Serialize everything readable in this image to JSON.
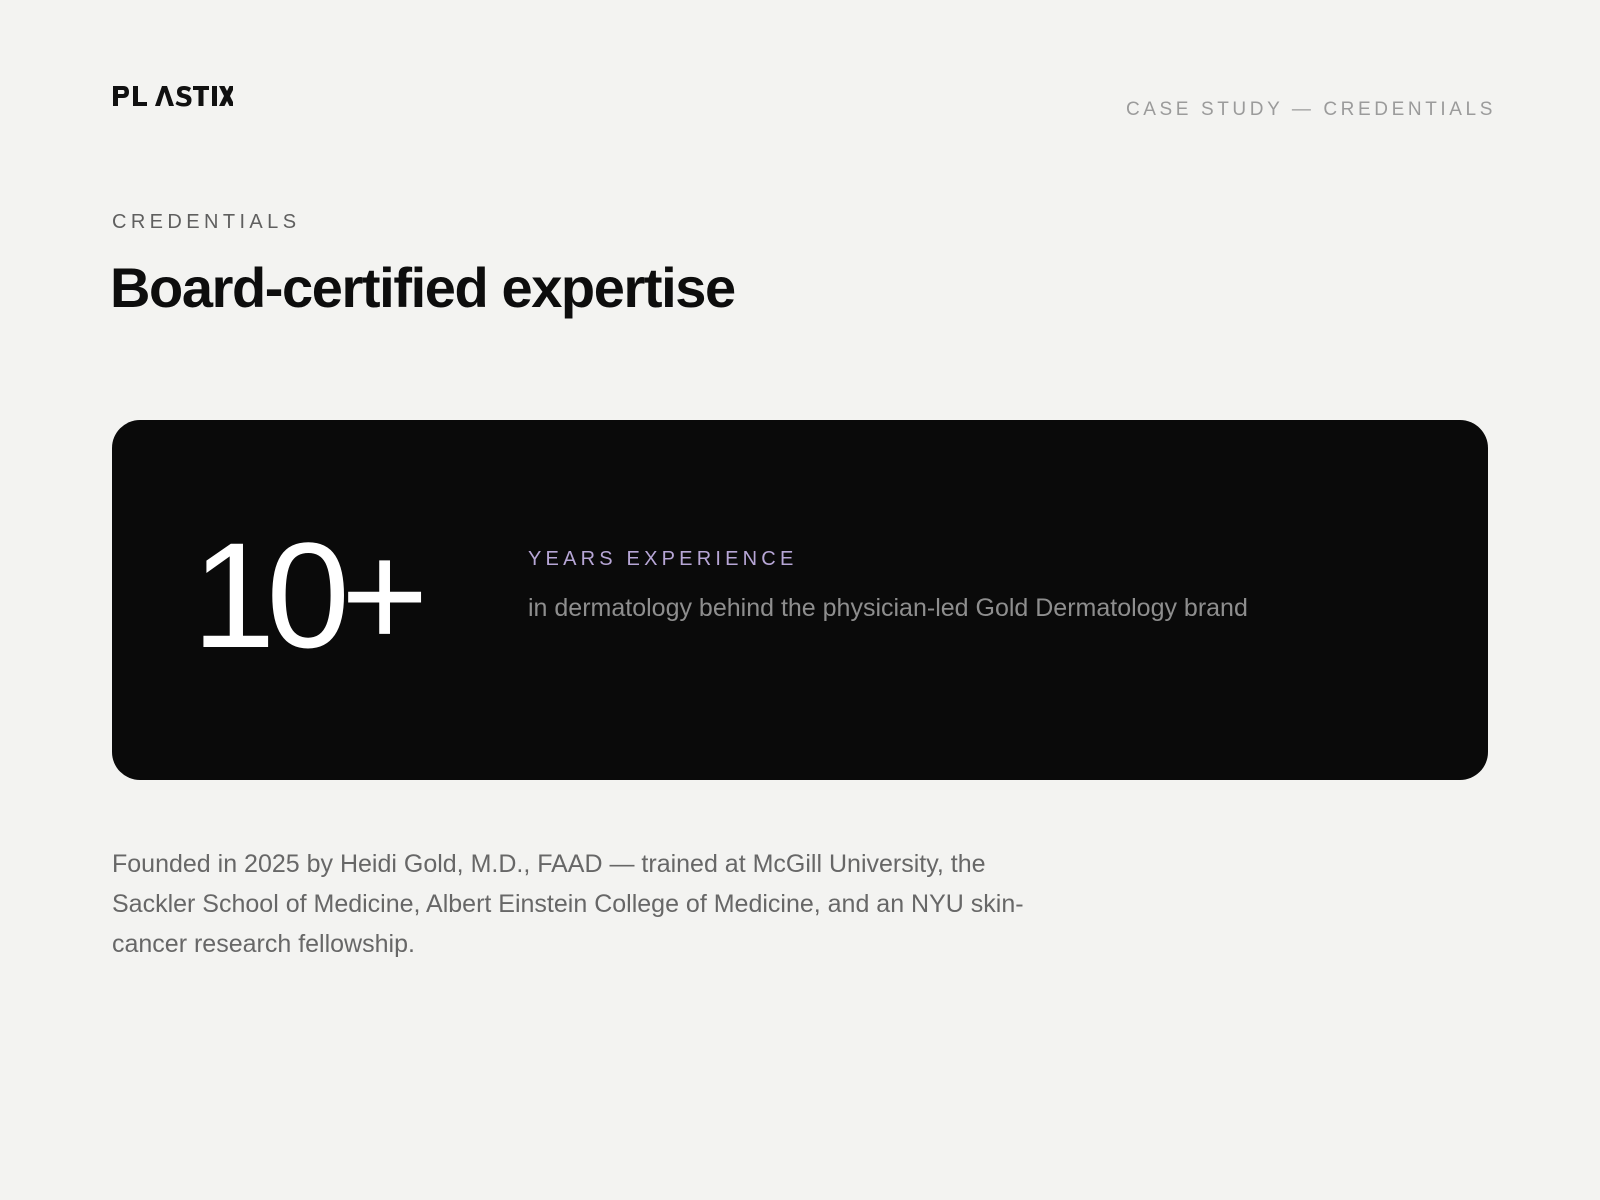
{
  "brand": {
    "logo_text": "PLASTIX"
  },
  "header": {
    "meta": "CASE STUDY — CREDENTIALS"
  },
  "section": {
    "eyebrow": "CREDENTIALS",
    "title": "Board-certified expertise"
  },
  "stat": {
    "value": "10+",
    "label": "YEARS EXPERIENCE",
    "description": "in dermatology behind the physician-led Gold Dermatology brand"
  },
  "body": {
    "text": "Founded in 2025 by Heidi Gold, M.D., FAAD — trained at McGill University, the Sackler School of Medicine, Albert Einstein College of Medicine, and an NYU skin-cancer research fellowship."
  },
  "colors": {
    "background": "#f3f3f1",
    "card": "#0a0a0a",
    "accent_label": "#b7a6d6",
    "heading": "#0d0d0d",
    "muted": "#676767"
  }
}
